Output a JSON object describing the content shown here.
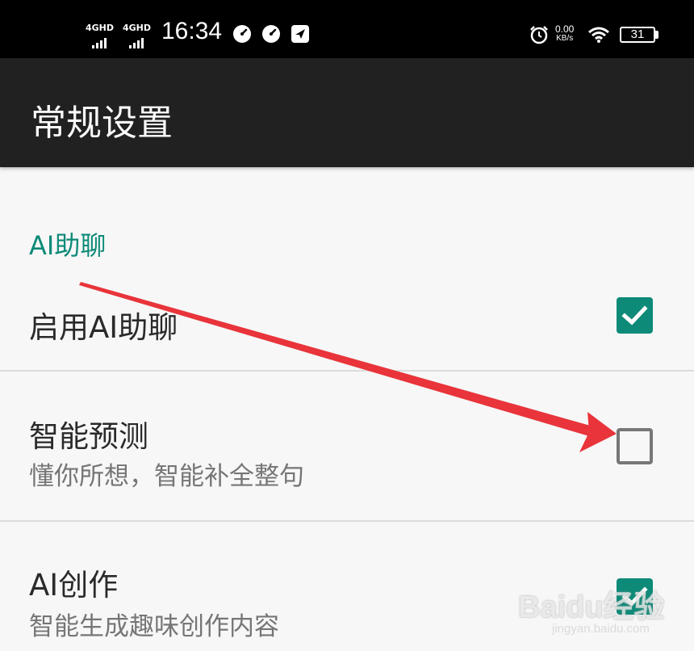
{
  "status_bar": {
    "signal_1": "4GHD",
    "signal_2": "4GHD",
    "time": "16:34",
    "net_rate_value": "0.00",
    "net_rate_unit": "KB/s",
    "battery": "31",
    "icons": [
      "speedometer-icon",
      "speedometer-icon",
      "send-icon",
      "alarm-icon",
      "wifi-icon",
      "battery-icon"
    ]
  },
  "app_bar": {
    "title": "常规设置"
  },
  "settings": {
    "category": "AI助聊",
    "items": [
      {
        "title": "启用AI助聊",
        "summary": "",
        "checked": true
      },
      {
        "title": "智能预测",
        "summary": "懂你所想，智能补全整句",
        "checked": false
      },
      {
        "title": "AI创作",
        "summary": "智能生成趣味创作内容",
        "checked": true
      }
    ]
  },
  "annotation": {
    "arrow_color": "#e8343a"
  },
  "watermark": {
    "main": "Baidu经验",
    "sub": "jingyan.baidu.com"
  },
  "colors": {
    "accent": "#0d8a78",
    "status_bar": "#000000",
    "app_bar": "#212121",
    "background": "#f7f7f7"
  }
}
